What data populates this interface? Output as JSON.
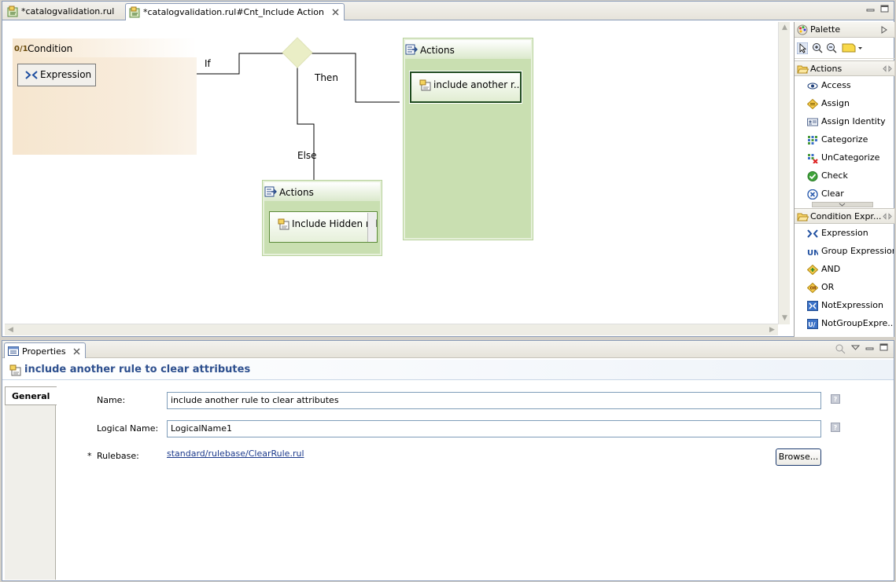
{
  "editor": {
    "tabs": [
      {
        "label": "*catalogvalidation.rul",
        "active": false
      },
      {
        "label": "*catalogvalidation.rul#Cnt_Include Action",
        "active": true
      }
    ]
  },
  "diagram": {
    "condition": {
      "title": "Condition",
      "expression_label": "Expression"
    },
    "branch_labels": {
      "if": "If",
      "then": "Then",
      "else": "Else"
    },
    "then_actions": {
      "title": "Actions",
      "item": "include another r..."
    },
    "else_actions": {
      "title": "Actions",
      "item": "Include Hidden rule"
    }
  },
  "palette": {
    "title": "Palette",
    "groups": [
      {
        "label": "Actions",
        "items": [
          "Access",
          "Assign",
          "Assign Identity",
          "Categorize",
          "UnCategorize",
          "Check",
          "Clear"
        ]
      },
      {
        "label": "Condition Expr...",
        "items": [
          "Expression",
          "Group Expression",
          "AND",
          "OR",
          "NotExpression",
          "NotGroupExpre..."
        ]
      }
    ]
  },
  "properties": {
    "view_tab": "Properties",
    "title": "include another rule to clear attributes",
    "side_tab": "General",
    "fields": {
      "name_label": "Name:",
      "name_value": "include another rule to clear attributes",
      "logical_label": "Logical Name:",
      "logical_value": "LogicalName1",
      "rulebase_required": "*",
      "rulebase_label": "Rulebase:",
      "rulebase_value": "standard/rulebase/ClearRule.rul",
      "browse_label": "Browse..."
    },
    "help_glyph": "?"
  },
  "colors": {
    "condition_fill": "#f6e6cf",
    "actions_fill": "#c9dfb1",
    "diamond_fill": "#eaeec6",
    "title_blue": "#2d4f8e",
    "link_blue": "#1c3a8c"
  }
}
